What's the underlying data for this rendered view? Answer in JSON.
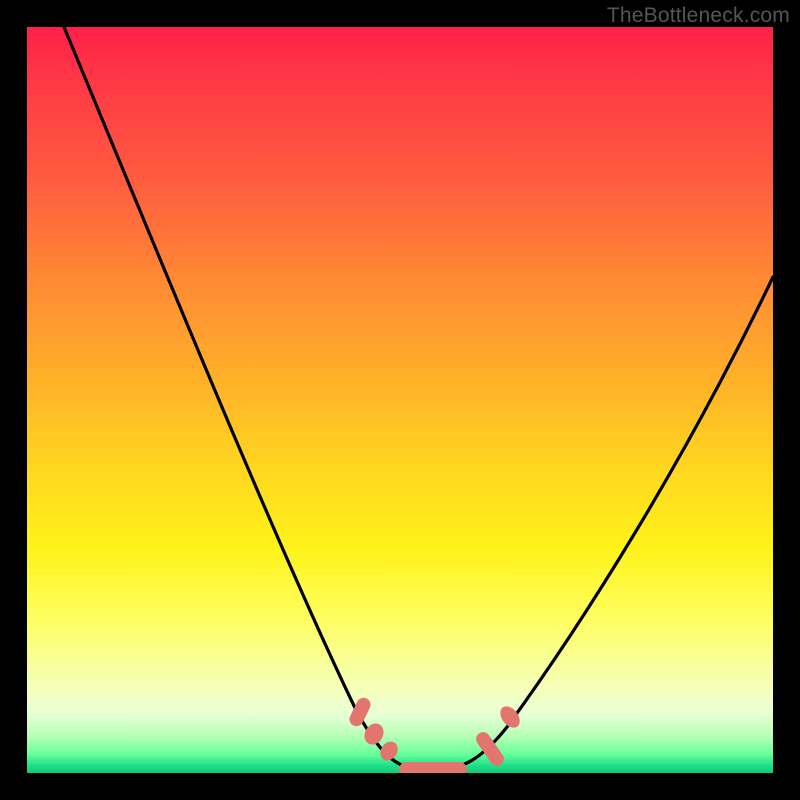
{
  "watermark": "TheBottleneck.com",
  "colors": {
    "frame": "#000000",
    "curve": "#000000",
    "markers": "#e2766f",
    "gradient_top": "#ff1f4a",
    "gradient_bottom": "#13c877"
  },
  "chart_data": {
    "type": "line",
    "title": "",
    "xlabel": "",
    "ylabel": "",
    "xlim": [
      0,
      100
    ],
    "ylim": [
      0,
      100
    ],
    "series": [
      {
        "name": "curve",
        "x": [
          5,
          10,
          15,
          20,
          25,
          30,
          35,
          40,
          45,
          48,
          50,
          52,
          54,
          56,
          58,
          60,
          65,
          70,
          75,
          80,
          85,
          90,
          95,
          100
        ],
        "y": [
          100,
          88,
          76,
          64,
          52,
          41,
          30,
          20,
          11,
          6,
          3,
          1,
          0,
          0,
          0,
          1,
          5,
          12,
          20,
          29,
          38,
          47,
          57,
          66
        ]
      }
    ],
    "markers": [
      {
        "name": "left-cluster",
        "x": [
          47,
          49,
          50
        ],
        "y": [
          8,
          5,
          3
        ]
      },
      {
        "name": "trough",
        "x": [
          52,
          54,
          56,
          58
        ],
        "y": [
          1,
          0,
          0,
          1
        ]
      },
      {
        "name": "right-cluster",
        "x": [
          61,
          63,
          64.5
        ],
        "y": [
          3,
          6,
          9
        ]
      }
    ]
  }
}
